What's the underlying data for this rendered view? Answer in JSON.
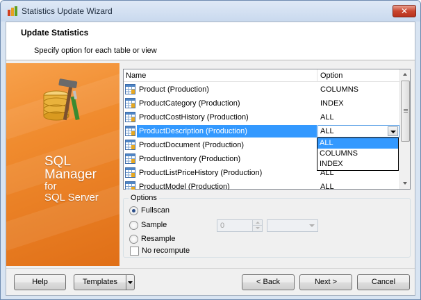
{
  "window": {
    "title": "Statistics Update Wizard",
    "close_glyph": "✕"
  },
  "header": {
    "title": "Update Statistics",
    "subtitle": "Specify option for each table or view"
  },
  "sidebar": {
    "brand_lines": [
      "SQL",
      "Manager",
      "for",
      "SQL Server"
    ]
  },
  "grid": {
    "columns": {
      "name": "Name",
      "option": "Option"
    },
    "rows": [
      {
        "name": "Product (Production)",
        "option": "COLUMNS"
      },
      {
        "name": "ProductCategory (Production)",
        "option": "INDEX"
      },
      {
        "name": "ProductCostHistory (Production)",
        "option": "ALL"
      },
      {
        "name": "ProductDescription (Production)",
        "option": "ALL"
      },
      {
        "name": "ProductDocument (Production)",
        "option": ""
      },
      {
        "name": "ProductInventory (Production)",
        "option": ""
      },
      {
        "name": "ProductListPriceHistory (Production)",
        "option": "ALL"
      },
      {
        "name": "ProductModel (Production)",
        "option": "ALL"
      }
    ],
    "dropdown_options": [
      "ALL",
      "COLUMNS",
      "INDEX"
    ],
    "dropdown_selected": "ALL"
  },
  "options": {
    "legend": "Options",
    "fullscan": "Fullscan",
    "sample": "Sample",
    "sample_value": "0",
    "resample": "Resample",
    "no_recompute": "No recompute"
  },
  "buttons": {
    "help": "Help",
    "templates": "Templates",
    "back": "< Back",
    "next": "Next >",
    "cancel": "Cancel"
  },
  "colors": {
    "selection": "#3399ff",
    "sidebar": "#f08b2e",
    "close": "#c9452e"
  }
}
